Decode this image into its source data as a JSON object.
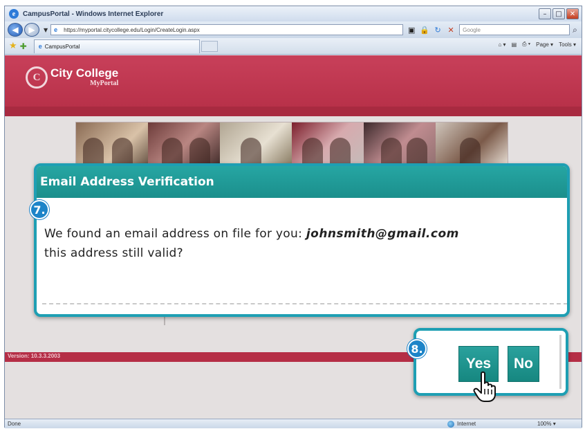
{
  "browser": {
    "window_title": "CampusPortal - Windows Internet Explorer",
    "url": "https://myportal.citycollege.edu/Login/CreateLogin.aspx",
    "search_placeholder": "Google",
    "tab_label": "CampusPortal",
    "cmd_page": "Page",
    "cmd_tools": "Tools",
    "status_text": "Done",
    "zone_text": "Internet",
    "zoom_text": "100%"
  },
  "portal": {
    "logo_name": "City College",
    "logo_sub": "MyPortal",
    "version": "Version: 10.3.3.2003"
  },
  "dialog": {
    "title": "Email Address Verification",
    "message_prefix": "We found an email address on file for you:",
    "email": "johnsmith@gmail.com",
    "message_suffix": "this address still valid?"
  },
  "steps": {
    "step7": "7.",
    "step8": "8."
  },
  "buttons": {
    "yes": "Yes",
    "no": "No"
  },
  "icons": {
    "back": "back-arrow-icon",
    "forward": "forward-arrow-icon",
    "favorites": "star-icon",
    "cursor": "hand-pointer-icon"
  },
  "colors": {
    "brand": "#b52e46",
    "dialog_accent": "#1e9fb3",
    "button": "#1b8f8c",
    "step_badge": "#1d84c8"
  }
}
